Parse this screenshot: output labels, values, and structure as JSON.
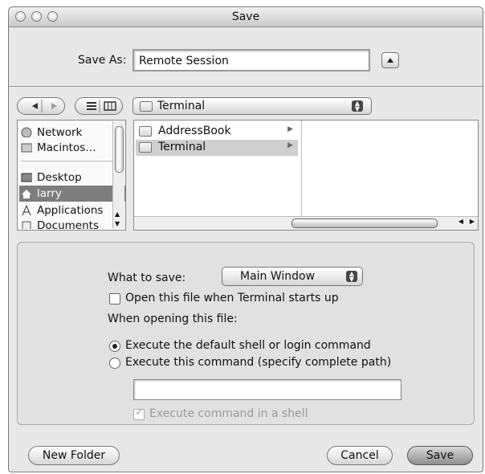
{
  "window": {
    "title": "Save"
  },
  "save_as": {
    "label": "Save As:",
    "value": "Remote Session"
  },
  "location": {
    "selected": "Terminal"
  },
  "sidebar": {
    "items": [
      {
        "label": "Network",
        "icon": "network-icon"
      },
      {
        "label": "Macintos…",
        "icon": "hard-disk-icon"
      },
      {
        "label": "Desktop",
        "icon": "desktop-icon"
      },
      {
        "label": "larry",
        "icon": "home-icon"
      },
      {
        "label": "Applications",
        "icon": "applications-icon"
      },
      {
        "label": "Documents",
        "icon": "documents-icon"
      }
    ]
  },
  "columns": {
    "column1": [
      {
        "label": "AddressBook"
      },
      {
        "label": "Terminal"
      }
    ]
  },
  "options": {
    "what_to_save_label": "What to save:",
    "what_to_save_value": "Main Window",
    "open_on_start_label": "Open this file when Terminal starts up",
    "when_opening_label": "When opening this file:",
    "radio_default_label": "Execute the default shell or login command",
    "radio_command_label": "Execute this command (specify complete path)",
    "command_value": "",
    "exec_in_shell_label": "Execute command in a shell"
  },
  "buttons": {
    "new_folder": "New Folder",
    "cancel": "Cancel",
    "save": "Save"
  },
  "colors": {
    "selection": "#8f8f8f",
    "highlight_sidebar": "#7d7d7d"
  }
}
